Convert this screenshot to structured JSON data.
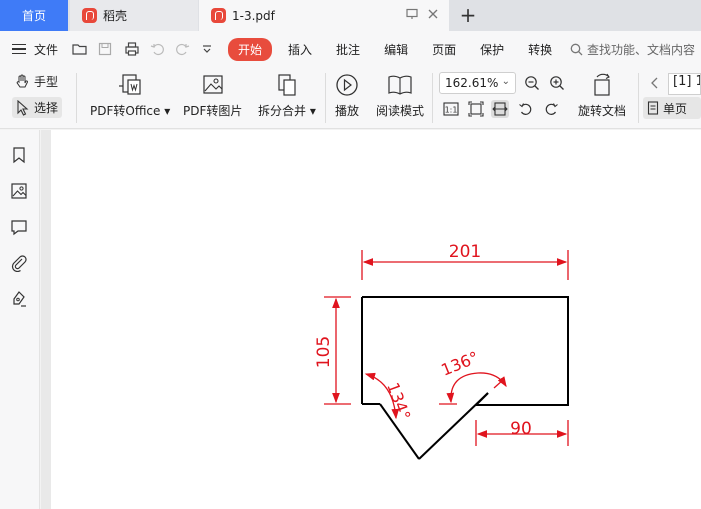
{
  "tabs": {
    "home": "首页",
    "daoke": "稻壳",
    "pdf": "1-3.pdf"
  },
  "menubar": {
    "file": "文件",
    "items": [
      "开始",
      "插入",
      "批注",
      "编辑",
      "页面",
      "保护",
      "转换"
    ],
    "search_placeholder": "查找功能、文档内容"
  },
  "ribbon": {
    "hand": "手型",
    "select": "选择",
    "pdf_to_office": "PDF转Office",
    "pdf_to_image": "PDF转图片",
    "split_merge": "拆分合并",
    "play": "播放",
    "read_mode": "阅读模式",
    "zoom": "162.61%",
    "rotate_doc": "旋转文档",
    "page_num": "[1] 1",
    "single_page": "单页"
  },
  "drawing": {
    "dim_top": "201",
    "dim_left": "105",
    "dim_bottom": "90",
    "angle_left": "134°",
    "angle_right": "136°",
    "color_dim": "#e0141e",
    "color_shape": "#000000"
  }
}
